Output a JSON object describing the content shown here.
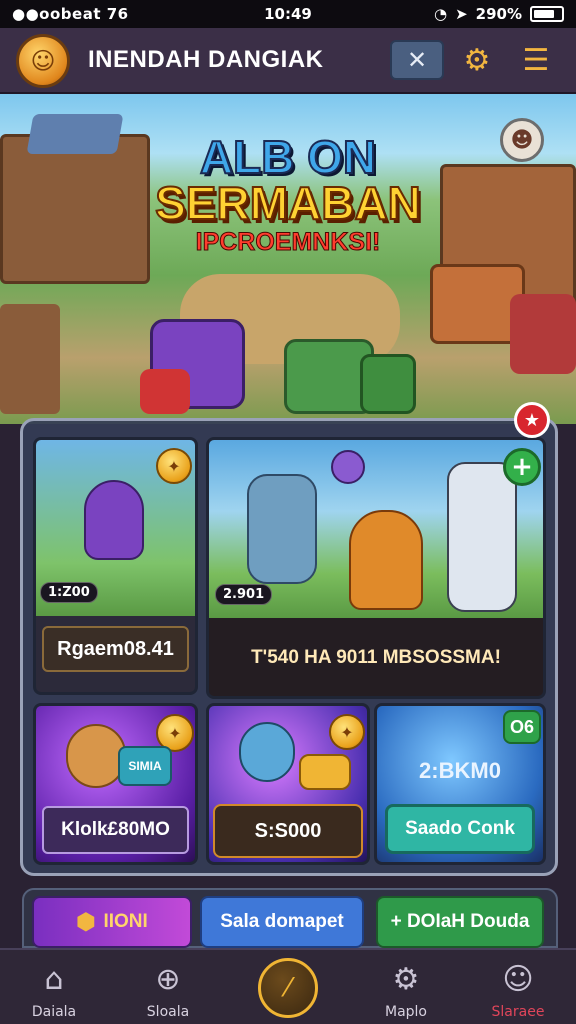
{
  "status_bar": {
    "carrier": "●●oobeat",
    "signal_extra": "76",
    "time": "10:49",
    "battery": "290%"
  },
  "header": {
    "title": "INENDAH DANGIAK"
  },
  "hero": {
    "title_line1": "ALB ON",
    "title_line2": "SERMABAN",
    "subtitle": "IPCROEMNKSI!"
  },
  "offers": {
    "card1": {
      "price_tag": "1:Z00",
      "label": "Rgaem08.41"
    },
    "card2": {
      "price_tag": "2.901",
      "label": "T'540 HA 9011 MBSOSSMA!"
    },
    "card3": {
      "badge": "SIMIA",
      "label": "Klolk£80MO"
    },
    "card4": {
      "button": "S:S000"
    },
    "card5": {
      "badge": "O6",
      "value": "2:BKM0",
      "button": "Saado Conk"
    }
  },
  "strip": {
    "btn1": "IIONI",
    "btn2": "Sala domapet",
    "btn3": "+ DOIaH Douda"
  },
  "nav": {
    "items": [
      {
        "label": "Daiala",
        "icon": "home-icon"
      },
      {
        "label": "Sloala",
        "icon": "search-icon"
      },
      {
        "label": "Maplo",
        "icon": "settings-icon"
      },
      {
        "label": "Slaraee",
        "icon": "profile-icon"
      }
    ]
  },
  "colors": {
    "header_bg": "#3b2f47",
    "accent_gold": "#f2b640",
    "panel_bg": "#343c56",
    "active_nav": "#e0455a"
  }
}
